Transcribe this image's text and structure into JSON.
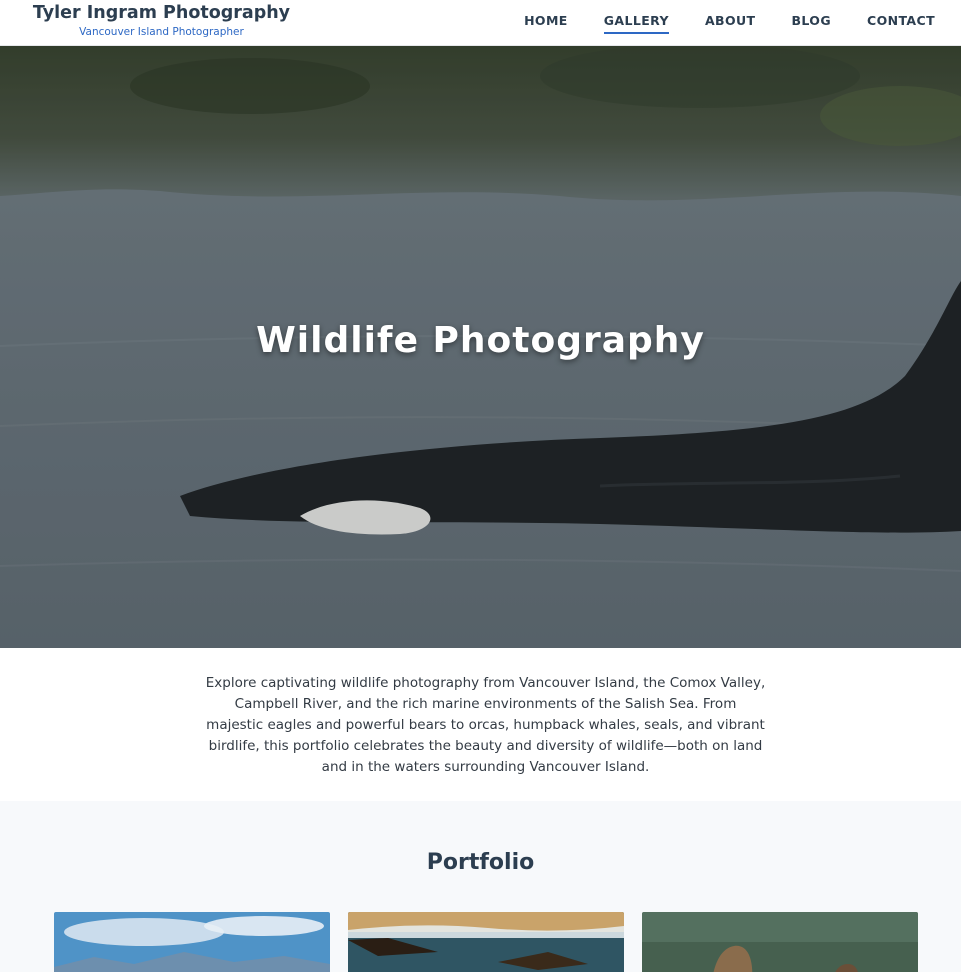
{
  "header": {
    "brand_title": "Tyler Ingram Photography",
    "brand_subtitle": "Vancouver Island Photographer",
    "nav": [
      {
        "label": "HOME"
      },
      {
        "label": "GALLERY",
        "active": true
      },
      {
        "label": "ABOUT"
      },
      {
        "label": "BLOG"
      },
      {
        "label": "CONTACT"
      }
    ]
  },
  "hero": {
    "title": "Wildlife Photography",
    "image": "orca-surfacing-photo"
  },
  "intro": {
    "text": "Explore captivating wildlife photography from Vancouver Island, the Comox Valley, Campbell River, and the rich marine environments of the Salish Sea. From majestic eagles and powerful bears to orcas, humpback whales, seals, and vibrant birdlife, this portfolio celebrates the beauty and diversity of wildlife—both on land and in the waters surrounding Vancouver Island."
  },
  "portfolio": {
    "heading": "Portfolio",
    "cards": [
      {
        "image": "sky-clouds-mountains-photo"
      },
      {
        "image": "eagle-over-water-photo"
      },
      {
        "image": "sea-lions-on-rocks-photo"
      }
    ]
  },
  "colors": {
    "text_dark": "#2c3e50",
    "accent_blue": "#2d68c4",
    "section_bg": "#f7f9fb"
  }
}
